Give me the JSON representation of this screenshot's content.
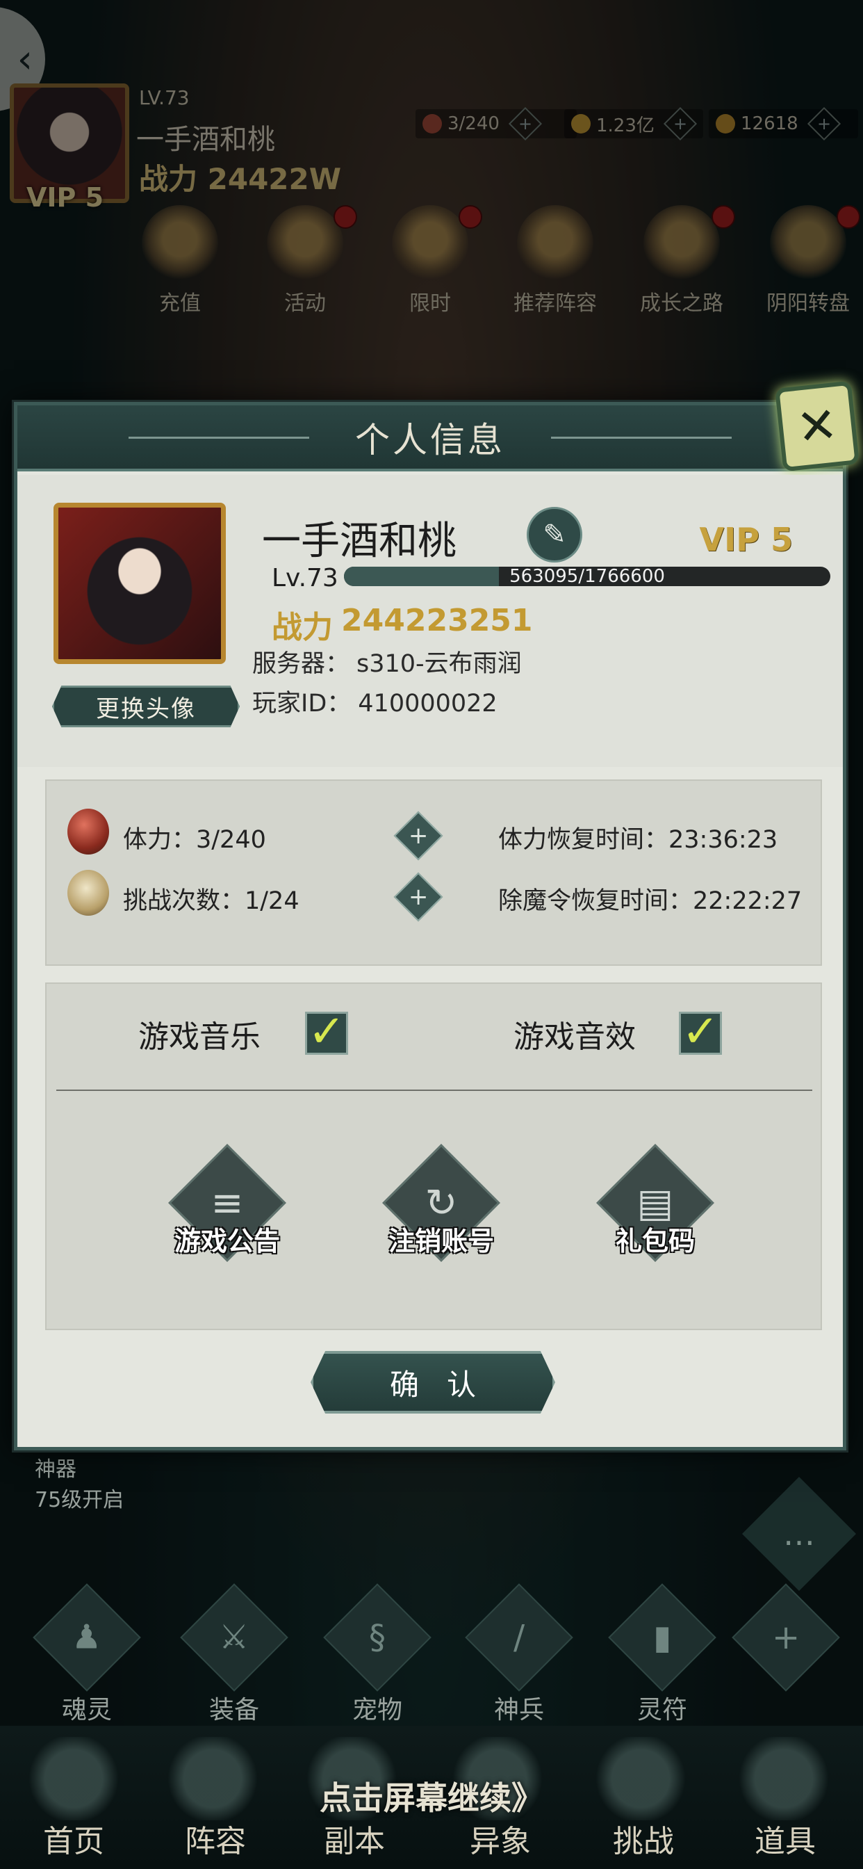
{
  "hud": {
    "level": "LV.73",
    "name": "一手酒和桃",
    "power": "战力 24422W",
    "vip": "VIP 5",
    "stamina": "3/240",
    "gold": "1.23亿",
    "gems": "12618",
    "plus": "+",
    "back": "‹"
  },
  "menu": [
    {
      "label": "充值"
    },
    {
      "label": "活动"
    },
    {
      "label": "限时"
    },
    {
      "label": "推荐阵容"
    },
    {
      "label": "成长之路"
    },
    {
      "label": "阴阳转盘"
    }
  ],
  "dialog": {
    "title": "个人信息",
    "close": "✕",
    "name": "一手酒和桃",
    "edit_icon": "✎",
    "vip": "VIP 5",
    "level": "Lv.73",
    "exp_text": "563095/1766600",
    "exp_fraction": 0.3187,
    "power_label": "战力",
    "power_value": "244223251",
    "server_label": "服务器：",
    "server_value": "s310-云布雨润",
    "player_id_label": "玩家ID：",
    "player_id_value": "410000022",
    "change_avatar": "更换头像",
    "stats": [
      {
        "label": "体力：3/240",
        "plus": "+",
        "time": "体力恢复时间：23:36:23"
      },
      {
        "label": "挑战次数：1/24",
        "plus": "+",
        "time": "除魔令恢复时间：22:22:27"
      }
    ],
    "settings": {
      "music_label": "游戏音乐",
      "sound_label": "游戏音效",
      "check": "✓"
    },
    "actions": [
      {
        "label": "游戏公告",
        "icon": "≡"
      },
      {
        "label": "注销账号",
        "icon": "↻"
      },
      {
        "label": "礼包码",
        "icon": "▤"
      }
    ],
    "confirm": "确认"
  },
  "scene": {
    "artifact_title": "神器",
    "artifact_unlock": "75级开启",
    "chat_icon": "…",
    "sub_nav": [
      {
        "label": "魂灵",
        "icon": "♟"
      },
      {
        "label": "装备",
        "icon": "⚔"
      },
      {
        "label": "宠物",
        "icon": "§"
      },
      {
        "label": "神兵",
        "icon": "/"
      },
      {
        "label": "灵符",
        "icon": "▮"
      },
      {
        "label": "",
        "icon": "+"
      }
    ],
    "continue_hint": "点击屏幕继续》",
    "tabs": [
      "首页",
      "阵容",
      "副本",
      "异象",
      "挑战",
      "道具"
    ]
  },
  "colors": {
    "accent_teal": "#2a4340",
    "gold": "#c39a32",
    "panel_bg": "#e4e6df",
    "check_green": "#d7e84f"
  }
}
